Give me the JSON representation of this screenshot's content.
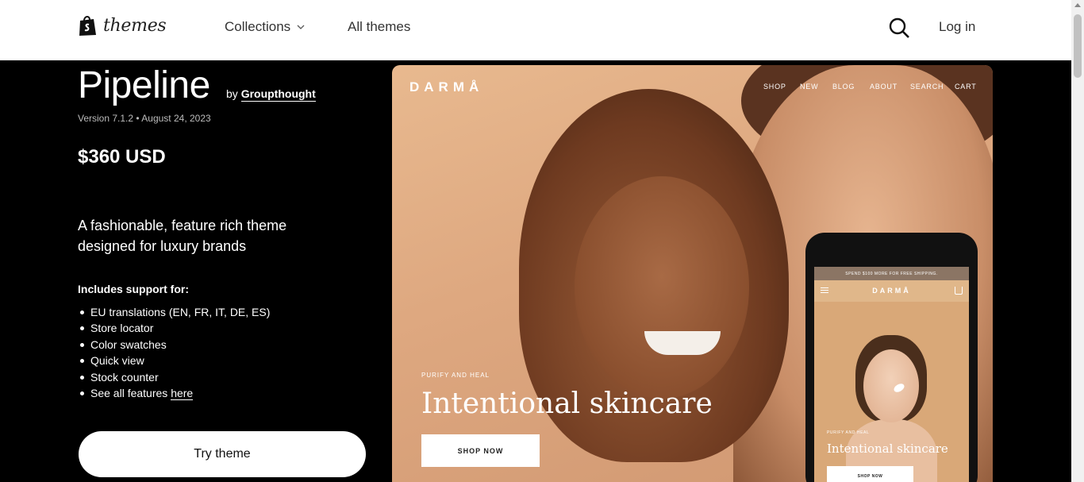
{
  "header": {
    "logo_text": "themes",
    "collections_label": "Collections",
    "all_themes_label": "All themes",
    "login_label": "Log in"
  },
  "theme": {
    "name": "Pipeline",
    "by_prefix": "by",
    "author": "Groupthought",
    "version_label": "Version 7.1.2",
    "date": "August 24, 2023",
    "price": "$360 USD",
    "tagline": "A fashionable, feature rich theme designed for luxury brands",
    "includes_heading": "Includes support for:",
    "features": [
      "EU translations (EN, FR, IT, DE, ES)",
      "Store locator",
      "Color swatches",
      "Quick view",
      "Stock counter"
    ],
    "see_all_prefix": "See all features",
    "see_all_link": "here",
    "try_button": "Try theme"
  },
  "preview": {
    "brand": "DARMÅ",
    "nav": [
      "SHOP",
      "NEW",
      "BLOG",
      "ABOUT",
      "SEARCH",
      "CART"
    ],
    "hero_sub": "PURIFY AND HEAL",
    "hero_title": "Intentional skincare",
    "shop_button": "SHOP NOW",
    "mobile": {
      "promo": "SPEND $100 MORE FOR FREE SHIPPING.",
      "brand": "DARMÅ",
      "hero_sub": "PURIFY AND HEAL",
      "hero_title": "Intentional skincare",
      "shop_button": "SHOP NOW"
    }
  }
}
